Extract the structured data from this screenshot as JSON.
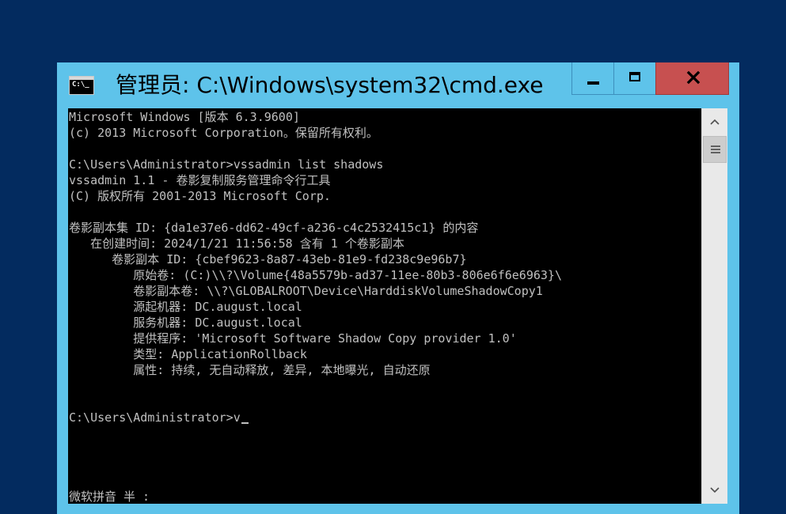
{
  "window": {
    "title": "管理员: C:\\Windows\\system32\\cmd.exe",
    "icon": "cmd-icon",
    "icon_text": "C:\\_",
    "buttons": {
      "minimize": "minimize-icon",
      "maximize": "maximize-icon",
      "close": "close-icon"
    },
    "close_color": "#c75050",
    "frame_color": "#5ec3ea"
  },
  "console": {
    "text_color": "#c0c0c0",
    "background": "#000000",
    "lines": [
      "Microsoft Windows [版本 6.3.9600]",
      "(c) 2013 Microsoft Corporation。保留所有权利。",
      "",
      "C:\\Users\\Administrator>vssadmin list shadows",
      "vssadmin 1.1 - 卷影复制服务管理命令行工具",
      "(C) 版权所有 2001-2013 Microsoft Corp.",
      "",
      "卷影副本集 ID: {da1e37e6-dd62-49cf-a236-c4c2532415c1} 的内容",
      "   在创建时间: 2024/1/21 11:56:58 含有 1 个卷影副本",
      "      卷影副本 ID: {cbef9623-8a87-43eb-81e9-fd238c9e96b7}",
      "         原始卷: (C:)\\\\?\\Volume{48a5579b-ad37-11ee-80b3-806e6f6e6963}\\",
      "         卷影副本卷: \\\\?\\GLOBALROOT\\Device\\HarddiskVolumeShadowCopy1",
      "         源起机器: DC.august.local",
      "         服务机器: DC.august.local",
      "         提供程序: 'Microsoft Software Shadow Copy provider 1.0'",
      "         类型: ApplicationRollback",
      "         属性: 持续, 无自动释放, 差异, 本地曝光, 自动还原",
      "",
      "",
      ""
    ],
    "input_line": "C:\\Users\\Administrator>v",
    "ime_status": "微软拼音 半 :"
  },
  "scrollbar": {
    "up": "chevron-up-icon",
    "down": "chevron-down-icon",
    "thumb": "grip-icon"
  }
}
